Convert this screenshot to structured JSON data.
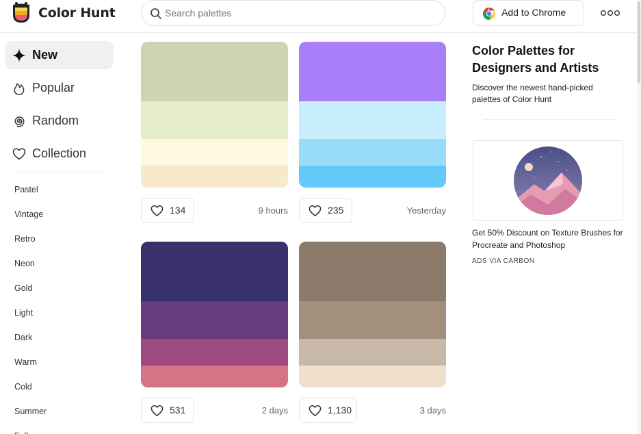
{
  "header": {
    "brand": "Color Hunt",
    "search_placeholder": "Search palettes",
    "chrome_button": "Add to Chrome"
  },
  "sidebar": {
    "nav": [
      {
        "label": "New",
        "icon": "sparkle-icon",
        "active": true
      },
      {
        "label": "Popular",
        "icon": "flame-icon",
        "active": false
      },
      {
        "label": "Random",
        "icon": "spiral-icon",
        "active": false
      },
      {
        "label": "Collection",
        "icon": "heart-icon",
        "active": false
      }
    ],
    "tags": [
      "Pastel",
      "Vintage",
      "Retro",
      "Neon",
      "Gold",
      "Light",
      "Dark",
      "Warm",
      "Cold",
      "Summer",
      "Fall"
    ]
  },
  "palettes": [
    {
      "colors": [
        "#CDD4B0",
        "#E6EDCA",
        "#FEF9E0",
        "#F7EACC"
      ],
      "likes": "134",
      "time": "9 hours"
    },
    {
      "colors": [
        "#A97FF9",
        "#C9EEFE",
        "#97DCF9",
        "#62C9F8"
      ],
      "likes": "235",
      "time": "Yesterday"
    },
    {
      "colors": [
        "#37306A",
        "#673B7E",
        "#9E4B82",
        "#D57487"
      ],
      "likes": "531",
      "time": "2 days"
    },
    {
      "colors": [
        "#8C7A6A",
        "#A38F7D",
        "#C8B8A8",
        "#EFDFCB"
      ],
      "likes": "1,130",
      "time": "3 days"
    }
  ],
  "right": {
    "title": "Color Palettes for Designers and Artists",
    "description": "Discover the newest hand-picked palettes of Color Hunt",
    "ad_text": "Get 50% Discount on Texture Brushes for Procreate and Photoshop",
    "ad_via": "ADS VIA CARBON"
  }
}
